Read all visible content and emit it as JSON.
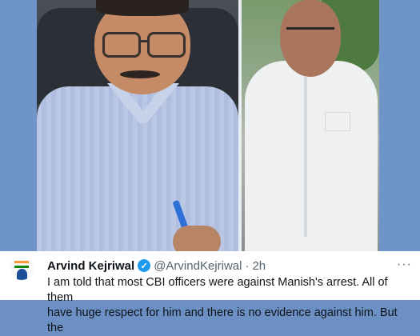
{
  "tweet": {
    "display_name": "Arvind Kejriwal",
    "handle": "@ArvindKejriwal",
    "separator": "·",
    "timestamp": "2h",
    "more_label": "···",
    "verified_label": "✓",
    "text_line_1": "I am told that most CBI officers were against Manish's arrest. All of them",
    "text_line_2": "have huge respect for him and there is no evidence against him. But the"
  },
  "icons": {
    "avatar": "avatar-icon",
    "verified": "verified-badge-icon",
    "more": "more-options-icon"
  },
  "colors": {
    "accent": "#1d9bf0",
    "text": "#0f1419",
    "muted": "#536471",
    "frame": "#6f94c8"
  }
}
